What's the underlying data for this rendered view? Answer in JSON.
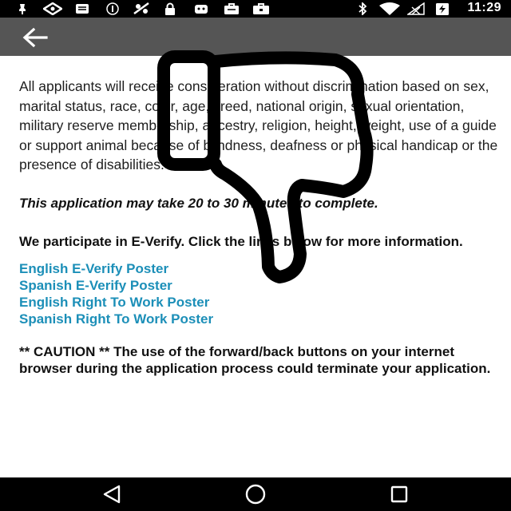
{
  "status_bar": {
    "time": "11:29",
    "left_icons": [
      "notification-icon",
      "drive-icon",
      "photos-icon",
      "nfc-icon",
      "no-pets-icon",
      "lock-icon",
      "android-debug-icon",
      "briefcase-icon",
      "suitcase-icon"
    ],
    "right_icons": [
      "bluetooth-icon",
      "wifi-icon",
      "no-signal-icon",
      "battery-charging-icon"
    ]
  },
  "app_bar": {
    "back_icon": "arrow-left-icon"
  },
  "content": {
    "intro": "All applicants will receive consideration without discrimination based on sex, marital status, race, color, age, creed, national origin, sexual orientation, military reserve membership, ancestry, religion, height, weight, use of a guide or support animal because of blindness, deafness or physical handicap or the presence of disabilities.",
    "time_note": "This application may take 20 to 30 minutes to complete.",
    "everify_note": "We participate in E-Verify. Click the links below for more information.",
    "links": [
      "English E-Verify Poster",
      "Spanish E-Verify Poster",
      "English Right To Work Poster",
      "Spanish Right To Work Poster"
    ],
    "caution": "** CAUTION ** The use of the forward/back buttons on your internet browser during the application process could terminate your application."
  },
  "nav_bar": {
    "buttons": [
      "back-triangle-icon",
      "home-circle-icon",
      "recents-square-icon"
    ]
  },
  "overlay": {
    "icon": "thumbs-down-icon"
  },
  "colors": {
    "link": "#1c8fb8",
    "app_bar": "#555555",
    "status_bar": "#000000"
  }
}
